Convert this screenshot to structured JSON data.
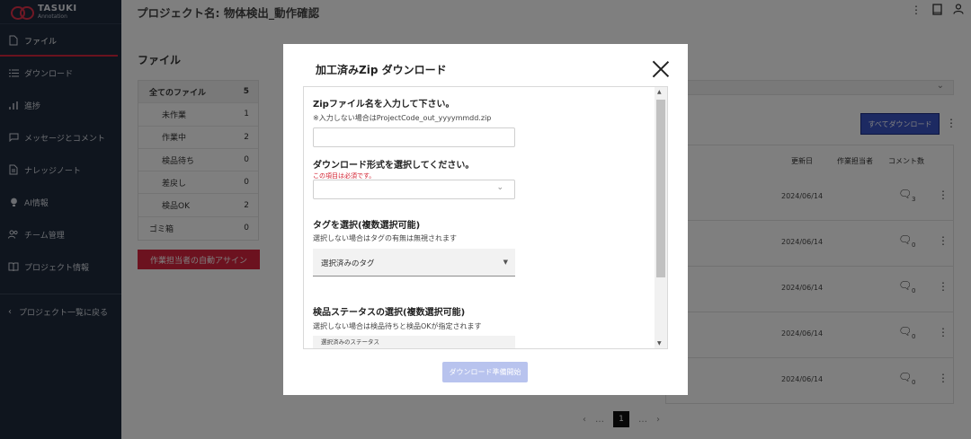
{
  "brand": {
    "name": "TASUKI",
    "sub": "Annotation"
  },
  "header": {
    "project_title": "プロジェクト名: 物体検出_動作確認"
  },
  "sidebar": {
    "items": [
      {
        "label": "ファイル",
        "icon": "file-icon"
      },
      {
        "label": "ダウンロード",
        "icon": "list-icon"
      },
      {
        "label": "進捗",
        "icon": "bar-chart-icon"
      },
      {
        "label": "メッセージとコメント",
        "icon": "comment-icon"
      },
      {
        "label": "ナレッジノート",
        "icon": "document-icon"
      },
      {
        "label": "AI情報",
        "icon": "bulb-icon"
      },
      {
        "label": "チーム管理",
        "icon": "people-icon"
      },
      {
        "label": "プロジェクト情報",
        "icon": "book-icon"
      }
    ],
    "back_label": "プロジェクト一覧に戻る"
  },
  "files": {
    "title": "ファイル",
    "rows": [
      {
        "label": "全てのファイル",
        "count": "5"
      },
      {
        "label": "未作業",
        "count": "1"
      },
      {
        "label": "作業中",
        "count": "2"
      },
      {
        "label": "検品待ち",
        "count": "0"
      },
      {
        "label": "差戻し",
        "count": "0"
      },
      {
        "label": "検品OK",
        "count": "2"
      },
      {
        "label": "ゴミ箱",
        "count": "0"
      }
    ],
    "assign_button": "作業担当者の自動アサイン"
  },
  "list": {
    "download_all": "すべてダウンロード",
    "columns": {
      "updated": "更新日",
      "assignee": "作業担当者",
      "comments": "コメント数"
    },
    "rows": [
      {
        "date": "2024/06/14",
        "comments": "3"
      },
      {
        "date": "2024/06/14",
        "comments": "0"
      },
      {
        "date": "2024/06/14",
        "comments": "0"
      },
      {
        "date": "2024/06/14",
        "comments": "0"
      },
      {
        "date": "2024/06/14",
        "comments": "0"
      }
    ],
    "pager": {
      "prev": "‹",
      "dots1": "…",
      "current": "1",
      "dots2": "…",
      "next": "›"
    }
  },
  "modal": {
    "title": "加工済みZip ダウンロード",
    "zip_name_label": "Zipファイル名を入力して下さい。",
    "zip_name_hint": "※入力しない場合はProjectCode_out_yyyymmdd.zip",
    "zip_name_value": "",
    "format_label": "ダウンロード形式を選択してください。",
    "format_error": "この項目は必須です。",
    "format_value": "",
    "tag_label": "タグを選択(複数選択可能)",
    "tag_hint": "選択しない場合はタグの有無は無視されます",
    "tag_placeholder": "選択済みのタグ",
    "status_label": "検品ステータスの選択(複数選択可能)",
    "status_hint": "選択しない場合は検品待ちと検品OKが指定されます",
    "status_placeholder": "選択済みのステータス",
    "start_button": "ダウンロード準備開始"
  },
  "colors": {
    "sidebar_bg": "#1f2a3c",
    "accent_red": "#d8253e",
    "primary_blue": "#3b54c4",
    "disabled_button": "#b8c3ee",
    "error_text": "#d11a2a"
  }
}
